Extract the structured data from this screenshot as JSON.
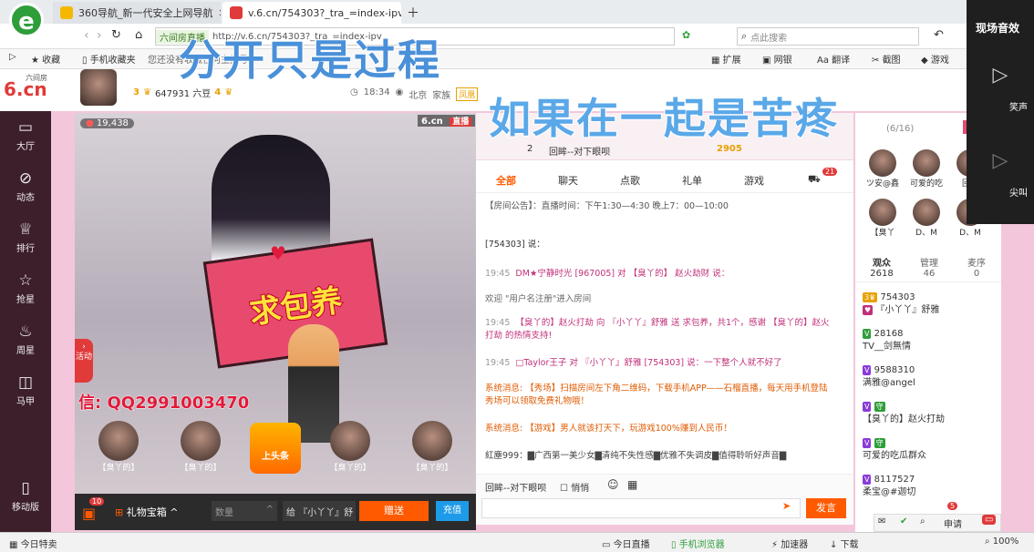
{
  "browser": {
    "tabs": [
      {
        "title": "360导航_新一代安全上网导航"
      },
      {
        "title": "v.6.cn/754303?_tra_=index-ipv"
      }
    ],
    "address_prefix": "六间房直播",
    "address": "http://v.6.cn/754303?_tra_=index-ipv",
    "search_placeholder": "点此搜索",
    "bookmarks": [
      "收藏",
      "手机收藏夹",
      "您还没有收藏任何主播号"
    ],
    "tools": [
      "扩展",
      "网银",
      "翻译",
      "截图",
      "游戏"
    ]
  },
  "site": {
    "logo": "6.cn",
    "logo_sub": "六间房",
    "stats": "647931 六豆",
    "level_a": "3",
    "level_b": "4",
    "time": "18:34",
    "location": "北京",
    "family": "家族",
    "family_tag": "凤凰"
  },
  "leftnav": [
    "大厅",
    "动态",
    "排行",
    "抢星",
    "周星",
    "马甲",
    "移动版"
  ],
  "video": {
    "viewers": "19,438",
    "brand": "6.cn",
    "live": "直播",
    "banner": "求包养",
    "activity": "活动",
    "watermark": "信: QQ2991003470",
    "seats": [
      "【臭丫的】",
      "【臭丫的】",
      "【臭丫的】",
      "【臭丫的】"
    ],
    "topseat": "上头条",
    "giftbox": "礼物宝箱",
    "qty_placeholder": "数量",
    "to_label": "给",
    "to_value": "『小丫丫』舒",
    "gift_btn": "赠送",
    "charge_btn": "充值",
    "gift_count": "10"
  },
  "chat": {
    "song": "回眸--对下眼呗",
    "rank": "2",
    "song_score": "2905",
    "tabs": [
      "全部",
      "聊天",
      "点歌",
      "礼单",
      "游戏"
    ],
    "tab_badge": "21",
    "notice": "【房间公告】：直播时间：下午1:30—4:30 晚上7：00—10:00",
    "messages": [
      {
        "time": "",
        "text": "[754303] 说："
      },
      {
        "time": "19:45",
        "text": "DM★宁静时光 [967005] 对 【臭丫的】 赵火劫财 说："
      },
      {
        "time": "",
        "text": "欢迎 \"用户名注册\"进入房间"
      },
      {
        "time": "19:45",
        "text": "【臭丫的】赵火打劫 向 『小丫丫』舒雅 送 求包养，共1个，感谢 【臭丫的】赵火打劫 的热情支持!"
      },
      {
        "time": "19:45",
        "text": "□Taylor王子 对 『小丫丫』舒雅 [754303] 说：一下整个人就不好了"
      },
      {
        "time": "",
        "text": "系统消息: 【秀场】扫描房间左下角二维码，下载手机APP——石榴直播，每天用手机登陆秀场可以领取免费礼物哦！"
      },
      {
        "time": "",
        "text": "系统消息: 【游戏】男人就该打天下，玩游戏100%赚到人民币！"
      },
      {
        "time": "",
        "text": "紅塵999：▇广西第一美少女▇清纯不失性感▇优雅不失调皮▇值得聆听好声音▇"
      }
    ],
    "input_target": "回眸--对下眼呗",
    "quiet_label": "悄悄",
    "send_btn": "发言"
  },
  "right": {
    "guard": "(6/16)",
    "open_btn": "开通",
    "guards": [
      "ツ安@鑫",
      "可爱的吃",
      "回眸",
      "【臭丫",
      "D、M",
      "D、M"
    ],
    "tabs": [
      {
        "label": "观众",
        "count": "2618"
      },
      {
        "label": "管理",
        "count": "46"
      },
      {
        "label": "麦序",
        "count": "0"
      }
    ],
    "users": [
      {
        "id": "754303",
        "name": "『小丫丫』舒雅"
      },
      {
        "id": "28168",
        "name": "TV__剑無情"
      },
      {
        "id": "9588310",
        "name": "满雅@angel"
      },
      {
        "id": "",
        "name": "【臭丫的】赵火打劫"
      },
      {
        "id": "",
        "name": "可爱的吃瓜群众"
      },
      {
        "id": "8117527",
        "name": "柔宝@#迦切"
      }
    ],
    "apply": "申请",
    "apply_count": "5"
  },
  "sfx": {
    "title": "现场音效",
    "items": [
      "笑声",
      "尖叫"
    ]
  },
  "overlay": {
    "line1": "分开只是过程",
    "line2": "如果在一起是苦疼"
  },
  "status": {
    "left": "今日特卖",
    "items": [
      "今日直播",
      "手机浏览器",
      "加速器",
      "下载",
      "100%"
    ]
  },
  "colors": {
    "accent": "#ff5a00",
    "brand": "#c0307a",
    "overlay": "#4a90d9"
  }
}
